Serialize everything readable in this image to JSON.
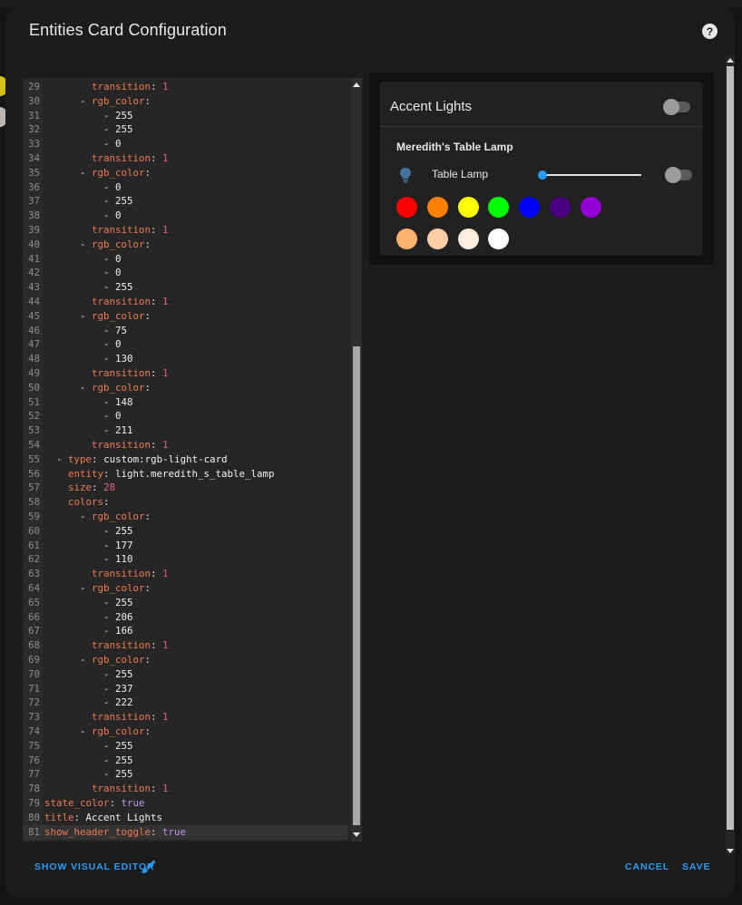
{
  "dialog": {
    "title": "Entities Card Configuration",
    "help_icon": "help-circle-icon",
    "buttons": {
      "show_visual_editor": "SHOW VISUAL EDITOR",
      "cancel": "CANCEL",
      "save": "SAVE"
    }
  },
  "editor": {
    "lines": [
      {
        "n": "29",
        "indent": "        ",
        "parts": [
          [
            "k",
            "transition"
          ],
          [
            "p",
            ": "
          ],
          [
            "n",
            "1"
          ]
        ]
      },
      {
        "n": "30",
        "indent": "      ",
        "parts": [
          [
            "p",
            "- "
          ],
          [
            "k",
            "rgb_color"
          ],
          [
            "p",
            ":"
          ]
        ]
      },
      {
        "n": "31",
        "indent": "          ",
        "parts": [
          [
            "p",
            "- "
          ],
          [
            "t",
            "255"
          ]
        ]
      },
      {
        "n": "32",
        "indent": "          ",
        "parts": [
          [
            "p",
            "- "
          ],
          [
            "t",
            "255"
          ]
        ]
      },
      {
        "n": "33",
        "indent": "          ",
        "parts": [
          [
            "p",
            "- "
          ],
          [
            "t",
            "0"
          ]
        ]
      },
      {
        "n": "34",
        "indent": "        ",
        "parts": [
          [
            "k",
            "transition"
          ],
          [
            "p",
            ": "
          ],
          [
            "n",
            "1"
          ]
        ]
      },
      {
        "n": "35",
        "indent": "      ",
        "parts": [
          [
            "p",
            "- "
          ],
          [
            "k",
            "rgb_color"
          ],
          [
            "p",
            ":"
          ]
        ]
      },
      {
        "n": "36",
        "indent": "          ",
        "parts": [
          [
            "p",
            "- "
          ],
          [
            "t",
            "0"
          ]
        ]
      },
      {
        "n": "37",
        "indent": "          ",
        "parts": [
          [
            "p",
            "- "
          ],
          [
            "t",
            "255"
          ]
        ]
      },
      {
        "n": "38",
        "indent": "          ",
        "parts": [
          [
            "p",
            "- "
          ],
          [
            "t",
            "0"
          ]
        ]
      },
      {
        "n": "39",
        "indent": "        ",
        "parts": [
          [
            "k",
            "transition"
          ],
          [
            "p",
            ": "
          ],
          [
            "n",
            "1"
          ]
        ]
      },
      {
        "n": "40",
        "indent": "      ",
        "parts": [
          [
            "p",
            "- "
          ],
          [
            "k",
            "rgb_color"
          ],
          [
            "p",
            ":"
          ]
        ]
      },
      {
        "n": "41",
        "indent": "          ",
        "parts": [
          [
            "p",
            "- "
          ],
          [
            "t",
            "0"
          ]
        ]
      },
      {
        "n": "42",
        "indent": "          ",
        "parts": [
          [
            "p",
            "- "
          ],
          [
            "t",
            "0"
          ]
        ]
      },
      {
        "n": "43",
        "indent": "          ",
        "parts": [
          [
            "p",
            "- "
          ],
          [
            "t",
            "255"
          ]
        ]
      },
      {
        "n": "44",
        "indent": "        ",
        "parts": [
          [
            "k",
            "transition"
          ],
          [
            "p",
            ": "
          ],
          [
            "n",
            "1"
          ]
        ]
      },
      {
        "n": "45",
        "indent": "      ",
        "parts": [
          [
            "p",
            "- "
          ],
          [
            "k",
            "rgb_color"
          ],
          [
            "p",
            ":"
          ]
        ]
      },
      {
        "n": "46",
        "indent": "          ",
        "parts": [
          [
            "p",
            "- "
          ],
          [
            "t",
            "75"
          ]
        ]
      },
      {
        "n": "47",
        "indent": "          ",
        "parts": [
          [
            "p",
            "- "
          ],
          [
            "t",
            "0"
          ]
        ]
      },
      {
        "n": "48",
        "indent": "          ",
        "parts": [
          [
            "p",
            "- "
          ],
          [
            "t",
            "130"
          ]
        ]
      },
      {
        "n": "49",
        "indent": "        ",
        "parts": [
          [
            "k",
            "transition"
          ],
          [
            "p",
            ": "
          ],
          [
            "n",
            "1"
          ]
        ]
      },
      {
        "n": "50",
        "indent": "      ",
        "parts": [
          [
            "p",
            "- "
          ],
          [
            "k",
            "rgb_color"
          ],
          [
            "p",
            ":"
          ]
        ]
      },
      {
        "n": "51",
        "indent": "          ",
        "parts": [
          [
            "p",
            "- "
          ],
          [
            "t",
            "148"
          ]
        ]
      },
      {
        "n": "52",
        "indent": "          ",
        "parts": [
          [
            "p",
            "- "
          ],
          [
            "t",
            "0"
          ]
        ]
      },
      {
        "n": "53",
        "indent": "          ",
        "parts": [
          [
            "p",
            "- "
          ],
          [
            "t",
            "211"
          ]
        ]
      },
      {
        "n": "54",
        "indent": "        ",
        "parts": [
          [
            "k",
            "transition"
          ],
          [
            "p",
            ": "
          ],
          [
            "n",
            "1"
          ]
        ]
      },
      {
        "n": "55",
        "indent": "  ",
        "parts": [
          [
            "p",
            "- "
          ],
          [
            "k",
            "type"
          ],
          [
            "p",
            ": "
          ],
          [
            "t",
            "custom:rgb-light-card"
          ]
        ]
      },
      {
        "n": "56",
        "indent": "    ",
        "parts": [
          [
            "k",
            "entity"
          ],
          [
            "p",
            ": "
          ],
          [
            "t",
            "light.meredith_s_table_lamp"
          ]
        ]
      },
      {
        "n": "57",
        "indent": "    ",
        "parts": [
          [
            "k",
            "size"
          ],
          [
            "p",
            ": "
          ],
          [
            "n",
            "28"
          ]
        ]
      },
      {
        "n": "58",
        "indent": "    ",
        "parts": [
          [
            "k",
            "colors"
          ],
          [
            "p",
            ":"
          ]
        ]
      },
      {
        "n": "59",
        "indent": "      ",
        "parts": [
          [
            "p",
            "- "
          ],
          [
            "k",
            "rgb_color"
          ],
          [
            "p",
            ":"
          ]
        ]
      },
      {
        "n": "60",
        "indent": "          ",
        "parts": [
          [
            "p",
            "- "
          ],
          [
            "t",
            "255"
          ]
        ]
      },
      {
        "n": "61",
        "indent": "          ",
        "parts": [
          [
            "p",
            "- "
          ],
          [
            "t",
            "177"
          ]
        ]
      },
      {
        "n": "62",
        "indent": "          ",
        "parts": [
          [
            "p",
            "- "
          ],
          [
            "t",
            "110"
          ]
        ]
      },
      {
        "n": "63",
        "indent": "        ",
        "parts": [
          [
            "k",
            "transition"
          ],
          [
            "p",
            ": "
          ],
          [
            "n",
            "1"
          ]
        ]
      },
      {
        "n": "64",
        "indent": "      ",
        "parts": [
          [
            "p",
            "- "
          ],
          [
            "k",
            "rgb_color"
          ],
          [
            "p",
            ":"
          ]
        ]
      },
      {
        "n": "65",
        "indent": "          ",
        "parts": [
          [
            "p",
            "- "
          ],
          [
            "t",
            "255"
          ]
        ]
      },
      {
        "n": "66",
        "indent": "          ",
        "parts": [
          [
            "p",
            "- "
          ],
          [
            "t",
            "206"
          ]
        ]
      },
      {
        "n": "67",
        "indent": "          ",
        "parts": [
          [
            "p",
            "- "
          ],
          [
            "t",
            "166"
          ]
        ]
      },
      {
        "n": "68",
        "indent": "        ",
        "parts": [
          [
            "k",
            "transition"
          ],
          [
            "p",
            ": "
          ],
          [
            "n",
            "1"
          ]
        ]
      },
      {
        "n": "69",
        "indent": "      ",
        "parts": [
          [
            "p",
            "- "
          ],
          [
            "k",
            "rgb_color"
          ],
          [
            "p",
            ":"
          ]
        ]
      },
      {
        "n": "70",
        "indent": "          ",
        "parts": [
          [
            "p",
            "- "
          ],
          [
            "t",
            "255"
          ]
        ]
      },
      {
        "n": "71",
        "indent": "          ",
        "parts": [
          [
            "p",
            "- "
          ],
          [
            "t",
            "237"
          ]
        ]
      },
      {
        "n": "72",
        "indent": "          ",
        "parts": [
          [
            "p",
            "- "
          ],
          [
            "t",
            "222"
          ]
        ]
      },
      {
        "n": "73",
        "indent": "        ",
        "parts": [
          [
            "k",
            "transition"
          ],
          [
            "p",
            ": "
          ],
          [
            "n",
            "1"
          ]
        ]
      },
      {
        "n": "74",
        "indent": "      ",
        "parts": [
          [
            "p",
            "- "
          ],
          [
            "k",
            "rgb_color"
          ],
          [
            "p",
            ":"
          ]
        ]
      },
      {
        "n": "75",
        "indent": "          ",
        "parts": [
          [
            "p",
            "- "
          ],
          [
            "t",
            "255"
          ]
        ]
      },
      {
        "n": "76",
        "indent": "          ",
        "parts": [
          [
            "p",
            "- "
          ],
          [
            "t",
            "255"
          ]
        ]
      },
      {
        "n": "77",
        "indent": "          ",
        "parts": [
          [
            "p",
            "- "
          ],
          [
            "t",
            "255"
          ]
        ]
      },
      {
        "n": "78",
        "indent": "        ",
        "parts": [
          [
            "k",
            "transition"
          ],
          [
            "p",
            ": "
          ],
          [
            "n",
            "1"
          ]
        ]
      },
      {
        "n": "79",
        "indent": "",
        "parts": [
          [
            "k",
            "state_color"
          ],
          [
            "p",
            ": "
          ],
          [
            "b",
            "true"
          ]
        ]
      },
      {
        "n": "80",
        "indent": "",
        "parts": [
          [
            "k",
            "title"
          ],
          [
            "p",
            ": "
          ],
          [
            "t",
            "Accent Lights"
          ]
        ]
      },
      {
        "n": "81",
        "indent": "",
        "parts": [
          [
            "k",
            "show_header_toggle"
          ],
          [
            "p",
            ": "
          ],
          [
            "b",
            "true"
          ]
        ],
        "active": true
      }
    ]
  },
  "preview": {
    "card_title": "Accent Lights",
    "header_toggle_on": false,
    "group_name": "Meredith's Table Lamp",
    "entity": {
      "icon": "lightbulb-icon",
      "label": "Table Lamp",
      "brightness": 0.0,
      "toggle_on": false
    },
    "swatches_row1": [
      "#ff0000",
      "#ff7f00",
      "#ffff00",
      "#00ff00",
      "#0000ff",
      "#4b0082",
      "#9400d3"
    ],
    "swatches_row2": [
      "#ffb16e",
      "#ffcea6",
      "#ffedde",
      "#ffffff"
    ]
  },
  "colors": {
    "accent": "#2a9cf5",
    "yaml_key": "#ee7a52",
    "yaml_number": "#e0607a",
    "yaml_bool": "#c792ea"
  }
}
